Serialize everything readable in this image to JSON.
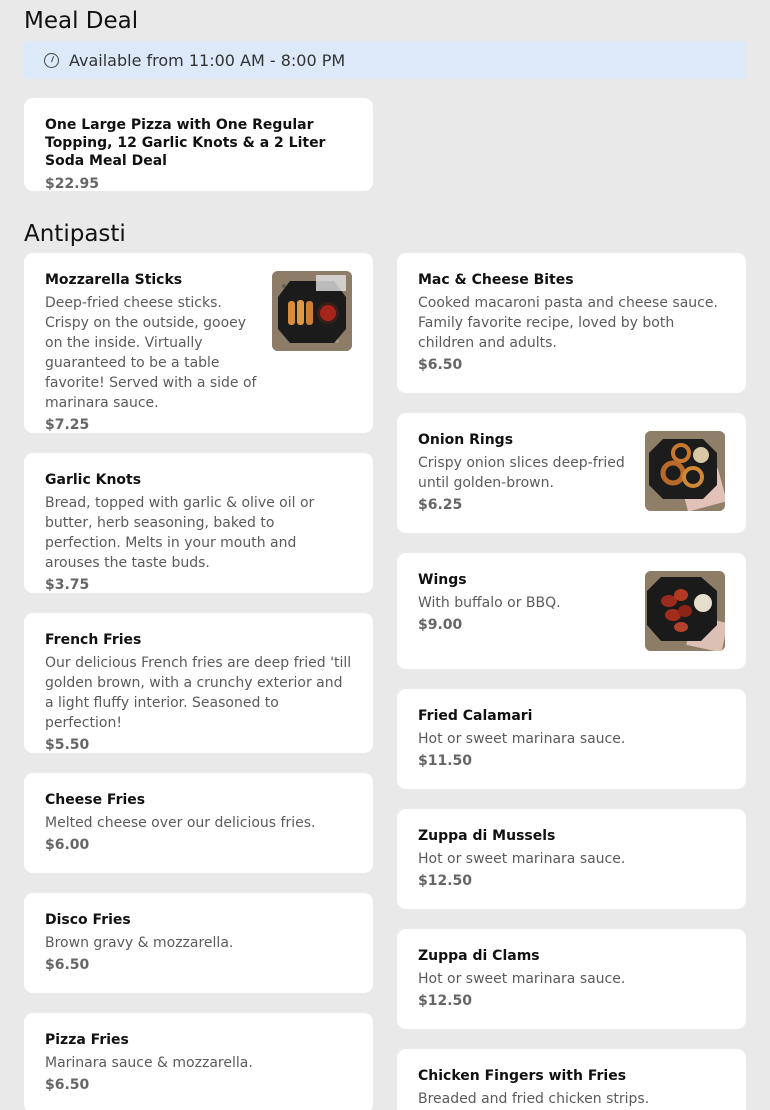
{
  "meal_deal": {
    "title": "Meal Deal",
    "availability": "Available from 11:00 AM - 8:00 PM",
    "items": [
      {
        "name": "One Large Pizza with One Regular Topping, 12 Garlic Knots & a 2 Liter Soda Meal Deal",
        "price": "$22.95"
      }
    ]
  },
  "antipasti": {
    "title": "Antipasti",
    "left": [
      {
        "name": "Mozzarella Sticks",
        "desc": "Deep-fried cheese sticks. Crispy on the outside, gooey on the inside. Virtually guaranteed to be a table favorite! Served with a side of marinara sauce.",
        "price": "$7.25",
        "image": "mozzarella-sticks-photo"
      },
      {
        "name": "Garlic Knots",
        "desc": "Bread, topped with garlic & olive oil or butter, herb seasoning, baked to perfection. Melts in your mouth and arouses the taste buds.",
        "price": "$3.75"
      },
      {
        "name": "French Fries",
        "desc": "Our delicious French fries are deep fried 'till golden brown, with a crunchy exterior and a light fluffy interior. Seasoned to perfection!",
        "price": "$5.50"
      },
      {
        "name": "Cheese Fries",
        "desc": "Melted cheese over our delicious fries.",
        "price": "$6.00"
      },
      {
        "name": "Disco Fries",
        "desc": "Brown gravy & mozzarella.",
        "price": "$6.50"
      },
      {
        "name": "Pizza Fries",
        "desc": "Marinara sauce & mozzarella.",
        "price": "$6.50"
      }
    ],
    "right": [
      {
        "name": "Mac & Cheese Bites",
        "desc": "Cooked macaroni pasta and cheese sauce. Family favorite recipe, loved by both children and adults.",
        "price": "$6.50"
      },
      {
        "name": "Onion Rings",
        "desc": "Crispy onion slices deep-fried until golden-brown.",
        "price": "$6.25",
        "image": "onion-rings-photo"
      },
      {
        "name": "Wings",
        "desc": "With buffalo or BBQ.",
        "price": "$9.00",
        "image": "wings-photo"
      },
      {
        "name": "Fried Calamari",
        "desc": "Hot or sweet marinara sauce.",
        "price": "$11.50"
      },
      {
        "name": "Zuppa di Mussels",
        "desc": "Hot or sweet marinara sauce.",
        "price": "$12.50"
      },
      {
        "name": "Zuppa di Clams",
        "desc": "Hot or sweet marinara sauce.",
        "price": "$12.50"
      },
      {
        "name": "Chicken Fingers with Fries",
        "desc": "Breaded and fried chicken strips.",
        "price": ""
      }
    ]
  }
}
